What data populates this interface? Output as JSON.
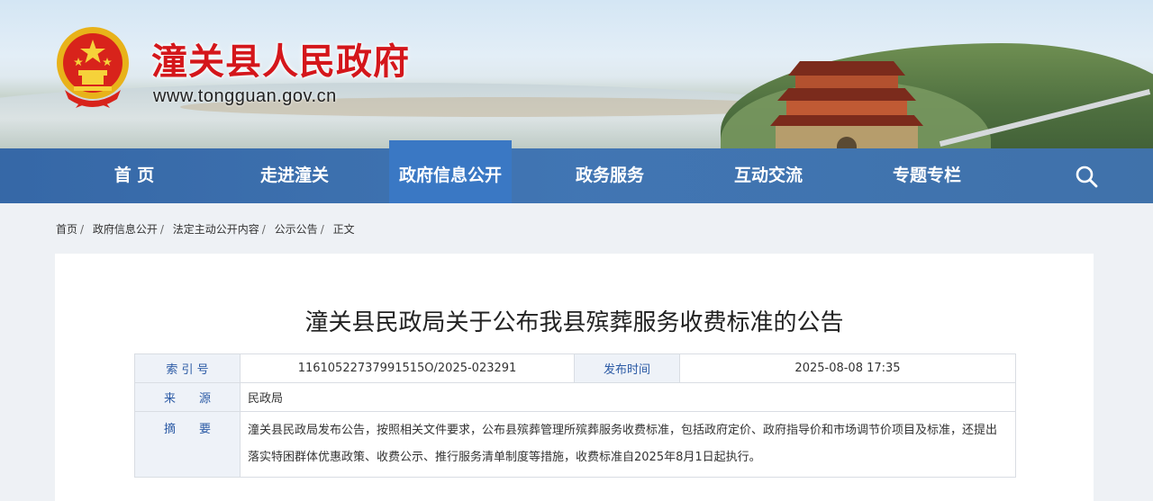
{
  "site": {
    "title": "潼关县人民政府",
    "url": "www.tongguan.gov.cn"
  },
  "nav": {
    "items": [
      {
        "label": "首 页"
      },
      {
        "label": "走进潼关"
      },
      {
        "label": "政府信息公开",
        "active": true
      },
      {
        "label": "政务服务"
      },
      {
        "label": "互动交流"
      },
      {
        "label": "专题专栏"
      }
    ],
    "search_icon": "search-icon"
  },
  "breadcrumb": {
    "items": [
      "首页",
      "政府信息公开",
      "法定主动公开内容",
      "公示公告"
    ],
    "current": "正文",
    "separator": "/"
  },
  "article": {
    "title": "潼关县民政局关于公布我县殡葬服务收费标准的公告",
    "meta": {
      "index_label": "索 引 号",
      "index_value": "11610522737991515O/2025-023291",
      "date_label": "发布时间",
      "date_value": "2025-08-08 17:35",
      "source_label": "来　　源",
      "source_value": "民政局",
      "summary_label": "摘　　要",
      "summary_value": "潼关县民政局发布公告，按照相关文件要求，公布县殡葬管理所殡葬服务收费标准，包括政府定价、政府指导价和市场调节价项目及标准，还提出落实特困群体优惠政策、收费公示、推行服务清单制度等措施，收费标准自2025年8月1日起执行。"
    }
  },
  "colors": {
    "title_red": "#d4161b",
    "nav_blue": "#2e68ac",
    "nav_active": "#3a78c4",
    "label_blue": "#2b5aa5",
    "label_bg": "#eef2f8"
  }
}
